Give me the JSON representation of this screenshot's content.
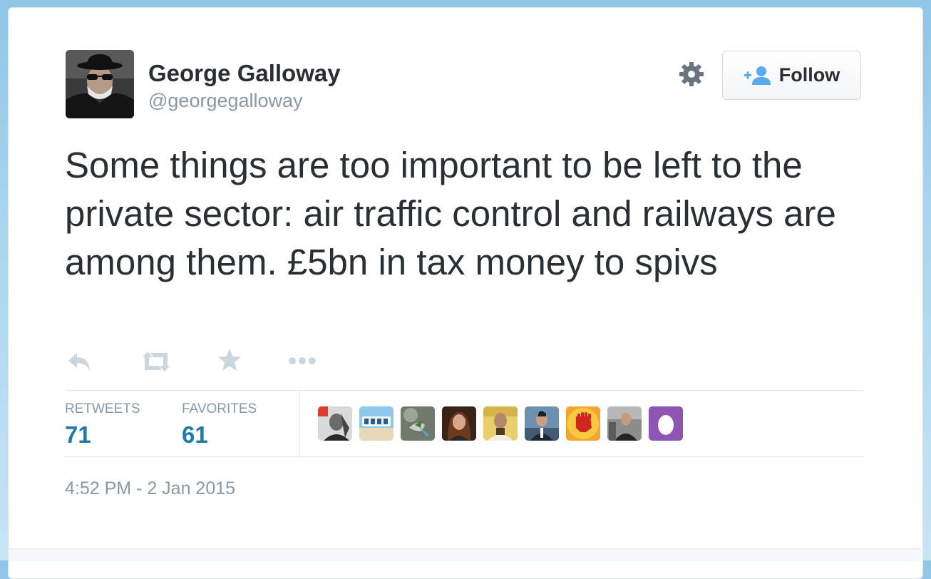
{
  "author": {
    "name": "George Galloway",
    "handle": "@georgegalloway",
    "avatar_icon": "profile-photo"
  },
  "header": {
    "follow_label": "Follow",
    "follow_icon": "add-user-icon",
    "settings_icon": "gear-icon"
  },
  "tweet": {
    "text": "Some things are too important to be left to the private sector: air traffic control and railways are among them. £5bn in tax money to spivs"
  },
  "actions": [
    {
      "name": "reply",
      "icon": "reply-icon"
    },
    {
      "name": "retweet",
      "icon": "retweet-icon"
    },
    {
      "name": "favorite",
      "icon": "star-icon"
    },
    {
      "name": "more",
      "icon": "more-icon"
    }
  ],
  "stats": {
    "retweets_label": "RETWEETS",
    "retweets_value": "71",
    "favorites_label": "FAVORITES",
    "favorites_value": "61"
  },
  "timestamp": "4:52 PM - 2 Jan 2015",
  "colors": {
    "link_blue": "#1b7dab",
    "text_dark": "#292f33",
    "text_gray": "#8899a6",
    "icon_gray": "#ccd6dd",
    "follow_icon_blue": "#55acee",
    "egg_purple": "#8d55b4"
  }
}
